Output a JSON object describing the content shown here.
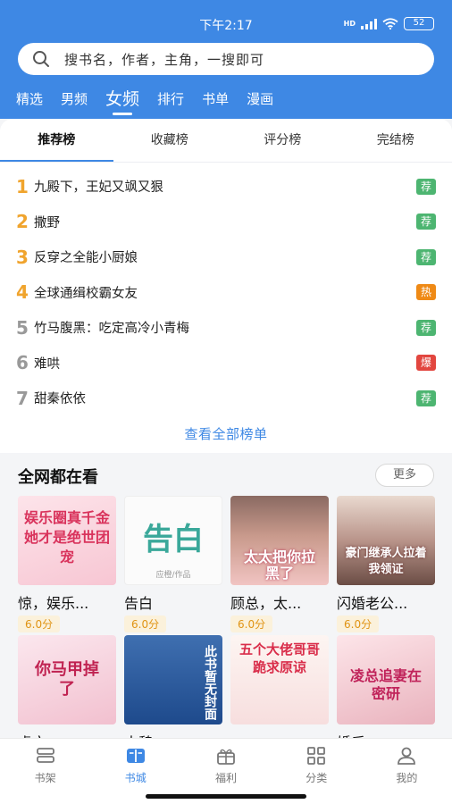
{
  "status_bar": {
    "time": "下午2:17",
    "network": "HD",
    "battery": "52"
  },
  "search": {
    "placeholder": "搜书名，作者，主角，一搜即可"
  },
  "top_tabs": [
    {
      "label": "精选"
    },
    {
      "label": "男频"
    },
    {
      "label": "女频",
      "active": true
    },
    {
      "label": "排行"
    },
    {
      "label": "书单"
    },
    {
      "label": "漫画"
    }
  ],
  "rank_tabs": [
    {
      "label": "推荐榜",
      "active": true
    },
    {
      "label": "收藏榜"
    },
    {
      "label": "评分榜"
    },
    {
      "label": "完结榜"
    }
  ],
  "rank_list": [
    {
      "rank": "1",
      "title": "九殿下，王妃又飒又狠",
      "badge": "荐",
      "badge_color": "#4db571"
    },
    {
      "rank": "2",
      "title": "撒野",
      "badge": "荐",
      "badge_color": "#4db571"
    },
    {
      "rank": "3",
      "title": "反穿之全能小厨娘",
      "badge": "荐",
      "badge_color": "#4db571"
    },
    {
      "rank": "4",
      "title": "全球通缉校霸女友",
      "badge": "热",
      "badge_color": "#ef8a16"
    },
    {
      "rank": "5",
      "title": "竹马腹黑：吃定高冷小青梅",
      "badge": "荐",
      "badge_color": "#4db571"
    },
    {
      "rank": "6",
      "title": "难哄",
      "badge": "爆",
      "badge_color": "#e2463f"
    },
    {
      "rank": "7",
      "title": "甜秦依依",
      "badge": "荐",
      "badge_color": "#4db571"
    }
  ],
  "view_all": "查看全部榜单",
  "section": {
    "title": "全网都在看",
    "more": "更多"
  },
  "books": [
    {
      "title": "惊，娱乐...",
      "score": "6.0分",
      "cover_text": "娱乐圈真千金她才是绝世团宠"
    },
    {
      "title": "告白",
      "score": "6.0分",
      "cover_text": "告白",
      "cover_sub": "应橙/作品"
    },
    {
      "title": "顾总，太...",
      "score": "6.0分",
      "cover_text": "太太把你拉黑了"
    },
    {
      "title": "闪婚老公...",
      "score": "6.0分",
      "cover_text": "豪门继承人拉着我领证"
    },
    {
      "title": "虐文...",
      "cover_text": "你马甲掉了"
    },
    {
      "title": "太魏...",
      "cover_text": "此书暂无封面"
    },
    {
      "title": "...",
      "cover_text": "五个大佬哥哥跪求原谅"
    },
    {
      "title": "婚后...",
      "cover_text": "凌总追妻在密研"
    }
  ],
  "bottom_nav": [
    {
      "label": "书架",
      "icon": "bookshelf-icon"
    },
    {
      "label": "书城",
      "icon": "bookstore-icon",
      "active": true
    },
    {
      "label": "福利",
      "icon": "gift-icon"
    },
    {
      "label": "分类",
      "icon": "grid-icon"
    },
    {
      "label": "我的",
      "icon": "user-icon"
    }
  ],
  "colors": {
    "accent": "#3e88e4",
    "rank_top": "#f0a42d",
    "score": "#e09415"
  }
}
